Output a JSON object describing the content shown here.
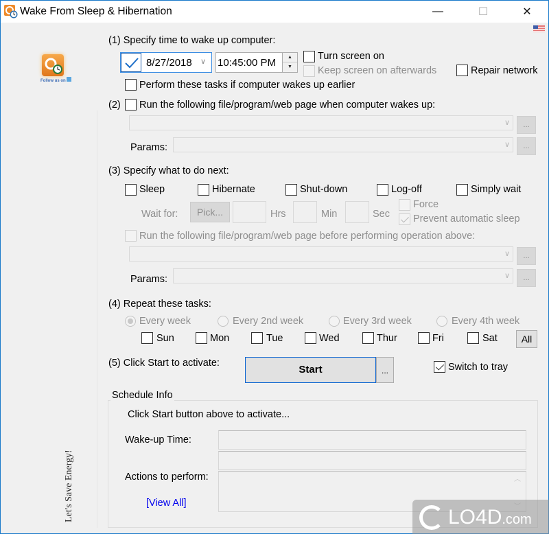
{
  "window": {
    "title": "Wake From Sleep & Hibernation",
    "controls": {
      "minimize": "—",
      "maximize": "☐",
      "close": "✕"
    },
    "language_flag": "us-flag-icon"
  },
  "sidebar": {
    "follow_text": "Follow us on",
    "slogan": "Let's Save Energy!"
  },
  "section1": {
    "heading": "(1) Specify time to wake up computer:",
    "date_enabled": true,
    "date_value": "8/27/2018",
    "time_value": "10:45:00 PM",
    "turn_screen_on": {
      "label": "Turn screen on",
      "checked": false
    },
    "keep_screen_on": {
      "label": "Keep screen on afterwards",
      "checked": false,
      "disabled": true
    },
    "repair_network": {
      "label": "Repair network",
      "checked": false
    },
    "perform_if_earlier": {
      "label": "Perform these tasks if computer wakes up earlier",
      "checked": false
    }
  },
  "section2": {
    "number": "(2)",
    "run_label": "Run the following file/program/web page when computer wakes up:",
    "run_checked": false,
    "file_value": "",
    "params_label": "Params:",
    "params_value": "",
    "browse_label": "..."
  },
  "section3": {
    "heading": "(3) Specify what to do next:",
    "actions": [
      {
        "label": "Sleep",
        "checked": false
      },
      {
        "label": "Hibernate",
        "checked": false
      },
      {
        "label": "Shut-down",
        "checked": false
      },
      {
        "label": "Log-off",
        "checked": false
      },
      {
        "label": "Simply wait",
        "checked": false
      }
    ],
    "wait_for_label": "Wait for:",
    "pick_label": "Pick...",
    "hrs_label": "Hrs",
    "min_label": "Min",
    "sec_label": "Sec",
    "hrs_value": "",
    "min_value": "",
    "sec_value": "",
    "force": {
      "label": "Force",
      "checked": false,
      "disabled": true
    },
    "prevent_sleep": {
      "label": "Prevent automatic sleep",
      "checked": true,
      "disabled": true
    },
    "run_before_label": "Run the following file/program/web page before performing operation above:",
    "run_before_checked": false,
    "file_value": "",
    "params_label": "Params:",
    "params_value": "",
    "browse_label": "..."
  },
  "section4": {
    "heading": "(4) Repeat these tasks:",
    "frequencies": [
      {
        "label": "Every week",
        "selected": true
      },
      {
        "label": "Every 2nd week",
        "selected": false
      },
      {
        "label": "Every 3rd week",
        "selected": false
      },
      {
        "label": "Every 4th week",
        "selected": false
      }
    ],
    "days": [
      {
        "label": "Sun",
        "checked": false
      },
      {
        "label": "Mon",
        "checked": false
      },
      {
        "label": "Tue",
        "checked": false
      },
      {
        "label": "Wed",
        "checked": false
      },
      {
        "label": "Thur",
        "checked": false
      },
      {
        "label": "Fri",
        "checked": false
      },
      {
        "label": "Sat",
        "checked": false
      }
    ],
    "all_label": "All"
  },
  "section5": {
    "heading": "(5) Click Start to activate:",
    "start_label": "Start",
    "more_label": "...",
    "switch_to_tray": {
      "label": "Switch to tray",
      "checked": true
    }
  },
  "schedule_info": {
    "title": "Schedule Info",
    "status": "Click Start button above to activate...",
    "wakeup_label": "Wake-up Time:",
    "wakeup_value": "",
    "wakeup_value2": "",
    "actions_label": "Actions to perform:",
    "actions_value": "",
    "view_all_label": "[View All]"
  },
  "watermark": {
    "text": "LO4D",
    "suffix": ".com"
  }
}
